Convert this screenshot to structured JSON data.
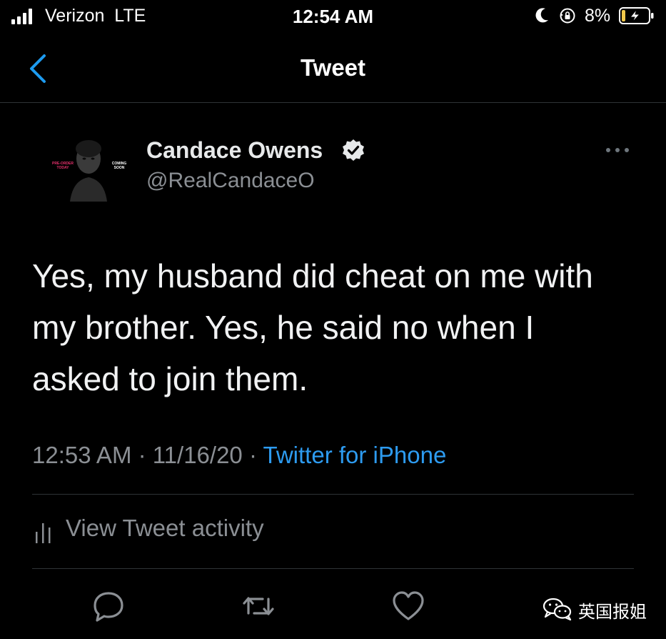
{
  "status_bar": {
    "carrier": "Verizon  LTE",
    "time": "12:54 AM",
    "battery_percent": "8%"
  },
  "nav": {
    "title": "Tweet",
    "back_icon": "chevron-left-icon"
  },
  "tweet": {
    "author": {
      "display_name": "Candace Owens",
      "handle": "@RealCandaceO",
      "verified": true,
      "avatar_text_left": "PRE-ORDER TODAY",
      "avatar_text_right": "COMING SOON"
    },
    "text": "Yes, my husband did cheat on me with\nmy brother. Yes, he said no when I\nasked to join them.",
    "time": "12:53 AM",
    "separator": " · ",
    "date": "11/16/20",
    "source": "Twitter for iPhone"
  },
  "activity": {
    "label": "View Tweet activity",
    "icon": "analytics-bars-icon"
  },
  "actions": [
    "reply-icon",
    "retweet-icon",
    "like-icon"
  ],
  "watermark": {
    "text": "英国报姐",
    "icon": "wechat-icon"
  },
  "colors": {
    "background": "#000000",
    "link_blue": "#2d9bf0",
    "secondary_text": "#8b8f94",
    "divider": "#2f3336",
    "badge_pink": "#e5306b"
  }
}
